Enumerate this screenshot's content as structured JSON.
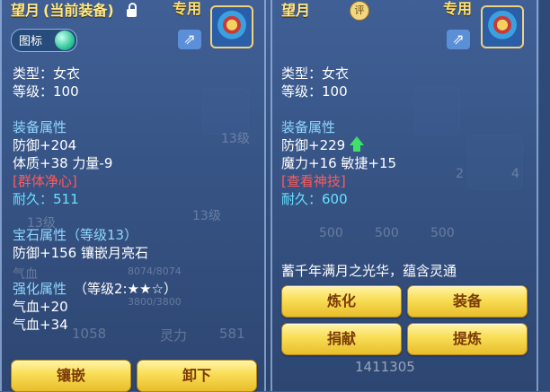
{
  "left_panel": {
    "item_name": "望月",
    "equipped_tag": "(当前装备)",
    "exclusive": "专用",
    "icon_toggle_label": "图标",
    "type_line": "类型：女衣",
    "level_line": "等级：100",
    "equip_section": "装备属性",
    "stats": [
      "防御+204",
      "体质+38 力量-9"
    ],
    "special_skill": "[群体净心]",
    "durability": "耐久：511",
    "gem_section": "宝石属性（等级13）",
    "gem_line": "防御+156 镶嵌月亮石",
    "enhance_section_label": "强化属性",
    "enhance_level": "（等级2:★★☆）",
    "enhance_lines": [
      "气血+20",
      "气血+34"
    ],
    "buttons": {
      "inlay": "镶嵌",
      "unequip": "卸下"
    }
  },
  "right_panel": {
    "item_name": "望月",
    "badge": "评",
    "exclusive": "专用",
    "type_line": "类型：女衣",
    "level_line": "等级：100",
    "equip_section": "装备属性",
    "defense": "防御+229",
    "magic_line": "魔力+16 敏捷+15",
    "divine_skill_link": "[查看神技]",
    "durability": "耐久：600",
    "description": "蓄千年满月之光华，蕴含灵通",
    "buttons": {
      "refine": "炼化",
      "equip": "装备",
      "donate": "捐献",
      "extract": "提炼"
    }
  },
  "background": {
    "hp_label": "气血",
    "hp_value": "8074/8074",
    "mp_value": "3800/3800",
    "spirit_label": "灵力",
    "spirit_value": "581",
    "left_value": "1058",
    "slot_level_a": "13级",
    "slot_level_b": "13级",
    "slot_level_c": "13级",
    "stack_500a": "500",
    "stack_500b": "500",
    "stack_500c": "500",
    "stack_2": "2",
    "stack_4": "4",
    "currency": "1411305"
  },
  "colors": {
    "name": "#ffe98a",
    "section": "#8fd8ff",
    "skill": "#ff5a5a",
    "durability": "#66e0ff",
    "button": "#f8dd55"
  }
}
